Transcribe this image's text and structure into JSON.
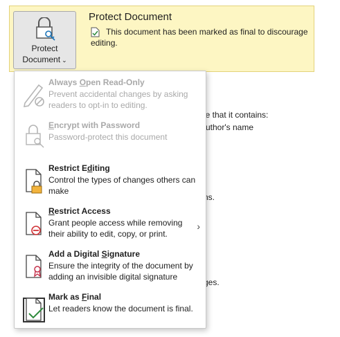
{
  "banner": {
    "protect_button": {
      "line1": "Protect",
      "line2": "Document",
      "chevron": "⌄"
    },
    "title": "Protect Document",
    "message_line1": "This document has been marked as final to discourage",
    "message_line2": "editing.",
    "icon": "document-check-icon",
    "colors": {
      "banner_bg": "#fdf6c3",
      "banner_border": "#e3d27a"
    }
  },
  "background_text": {
    "line1": "are that it contains:",
    "line2": "uthor's name",
    "line3": "ns.",
    "line4": "ges."
  },
  "menu": {
    "items": [
      {
        "title_pre": "Always ",
        "title_u": "O",
        "title_post": "pen Read-Only",
        "desc": "Prevent accidental changes by asking readers to opt-in to editing.",
        "icon": "pencil-disabled-icon",
        "disabled": true
      },
      {
        "title_pre": "",
        "title_u": "E",
        "title_post": "ncrypt with Password",
        "desc": "Password-protect this document",
        "icon": "document-lock-icon",
        "disabled": true
      },
      {
        "title_pre": "Restrict E",
        "title_u": "d",
        "title_post": "iting",
        "desc": "Control the types of changes others can make",
        "icon": "document-lock-icon",
        "disabled": false
      },
      {
        "title_pre": "",
        "title_u": "R",
        "title_post": "estrict Access",
        "desc": "Grant people access while removing their ability to edit, copy, or print.",
        "icon": "document-restrict-icon",
        "disabled": false,
        "has_submenu": true,
        "submenu_glyph": "›"
      },
      {
        "title_pre": "Add a Digital ",
        "title_u": "S",
        "title_post": "ignature",
        "desc": "Ensure the integrity of the document by adding an invisible digital signature",
        "icon": "document-ribbon-icon",
        "disabled": false
      },
      {
        "title_pre": "Mark as ",
        "title_u": "F",
        "title_post": "inal",
        "desc": "Let readers know the document is final.",
        "icon": "document-final-check-icon",
        "disabled": false
      }
    ]
  }
}
